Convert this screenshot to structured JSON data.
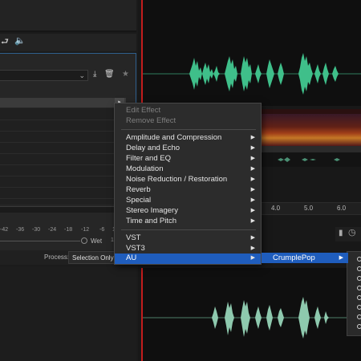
{
  "effects_rack": {
    "scale_ticks": [
      "-42",
      "-36",
      "-30",
      "-24",
      "-18",
      "-12",
      "-6",
      "10"
    ],
    "wet_label": "Wet",
    "process_label": "Process:",
    "process_value": "Selection Only"
  },
  "timeline": {
    "ruler_ticks": [
      "4.0",
      "5.0",
      "6.0"
    ]
  },
  "context_menu": {
    "disabled_items": [
      "Edit Effect",
      "Remove Effect"
    ],
    "effect_categories": [
      "Amplitude and Compression",
      "Delay and Echo",
      "Filter and EQ",
      "Modulation",
      "Noise Reduction / Restoration",
      "Reverb",
      "Special",
      "Stereo Imagery",
      "Time and Pitch"
    ],
    "plugin_formats": [
      "VST",
      "VST3",
      "AU"
    ],
    "selected_item": "AU"
  },
  "au_submenu": {
    "vendor": "CrumplePop"
  },
  "colors": {
    "waveform_top": "#3fbf8a",
    "waveform_bottom": "#8ec9ae",
    "menu_highlight": "#1f5dbd",
    "playhead": "#c21c1c",
    "panel_border": "#2f5f8e"
  }
}
